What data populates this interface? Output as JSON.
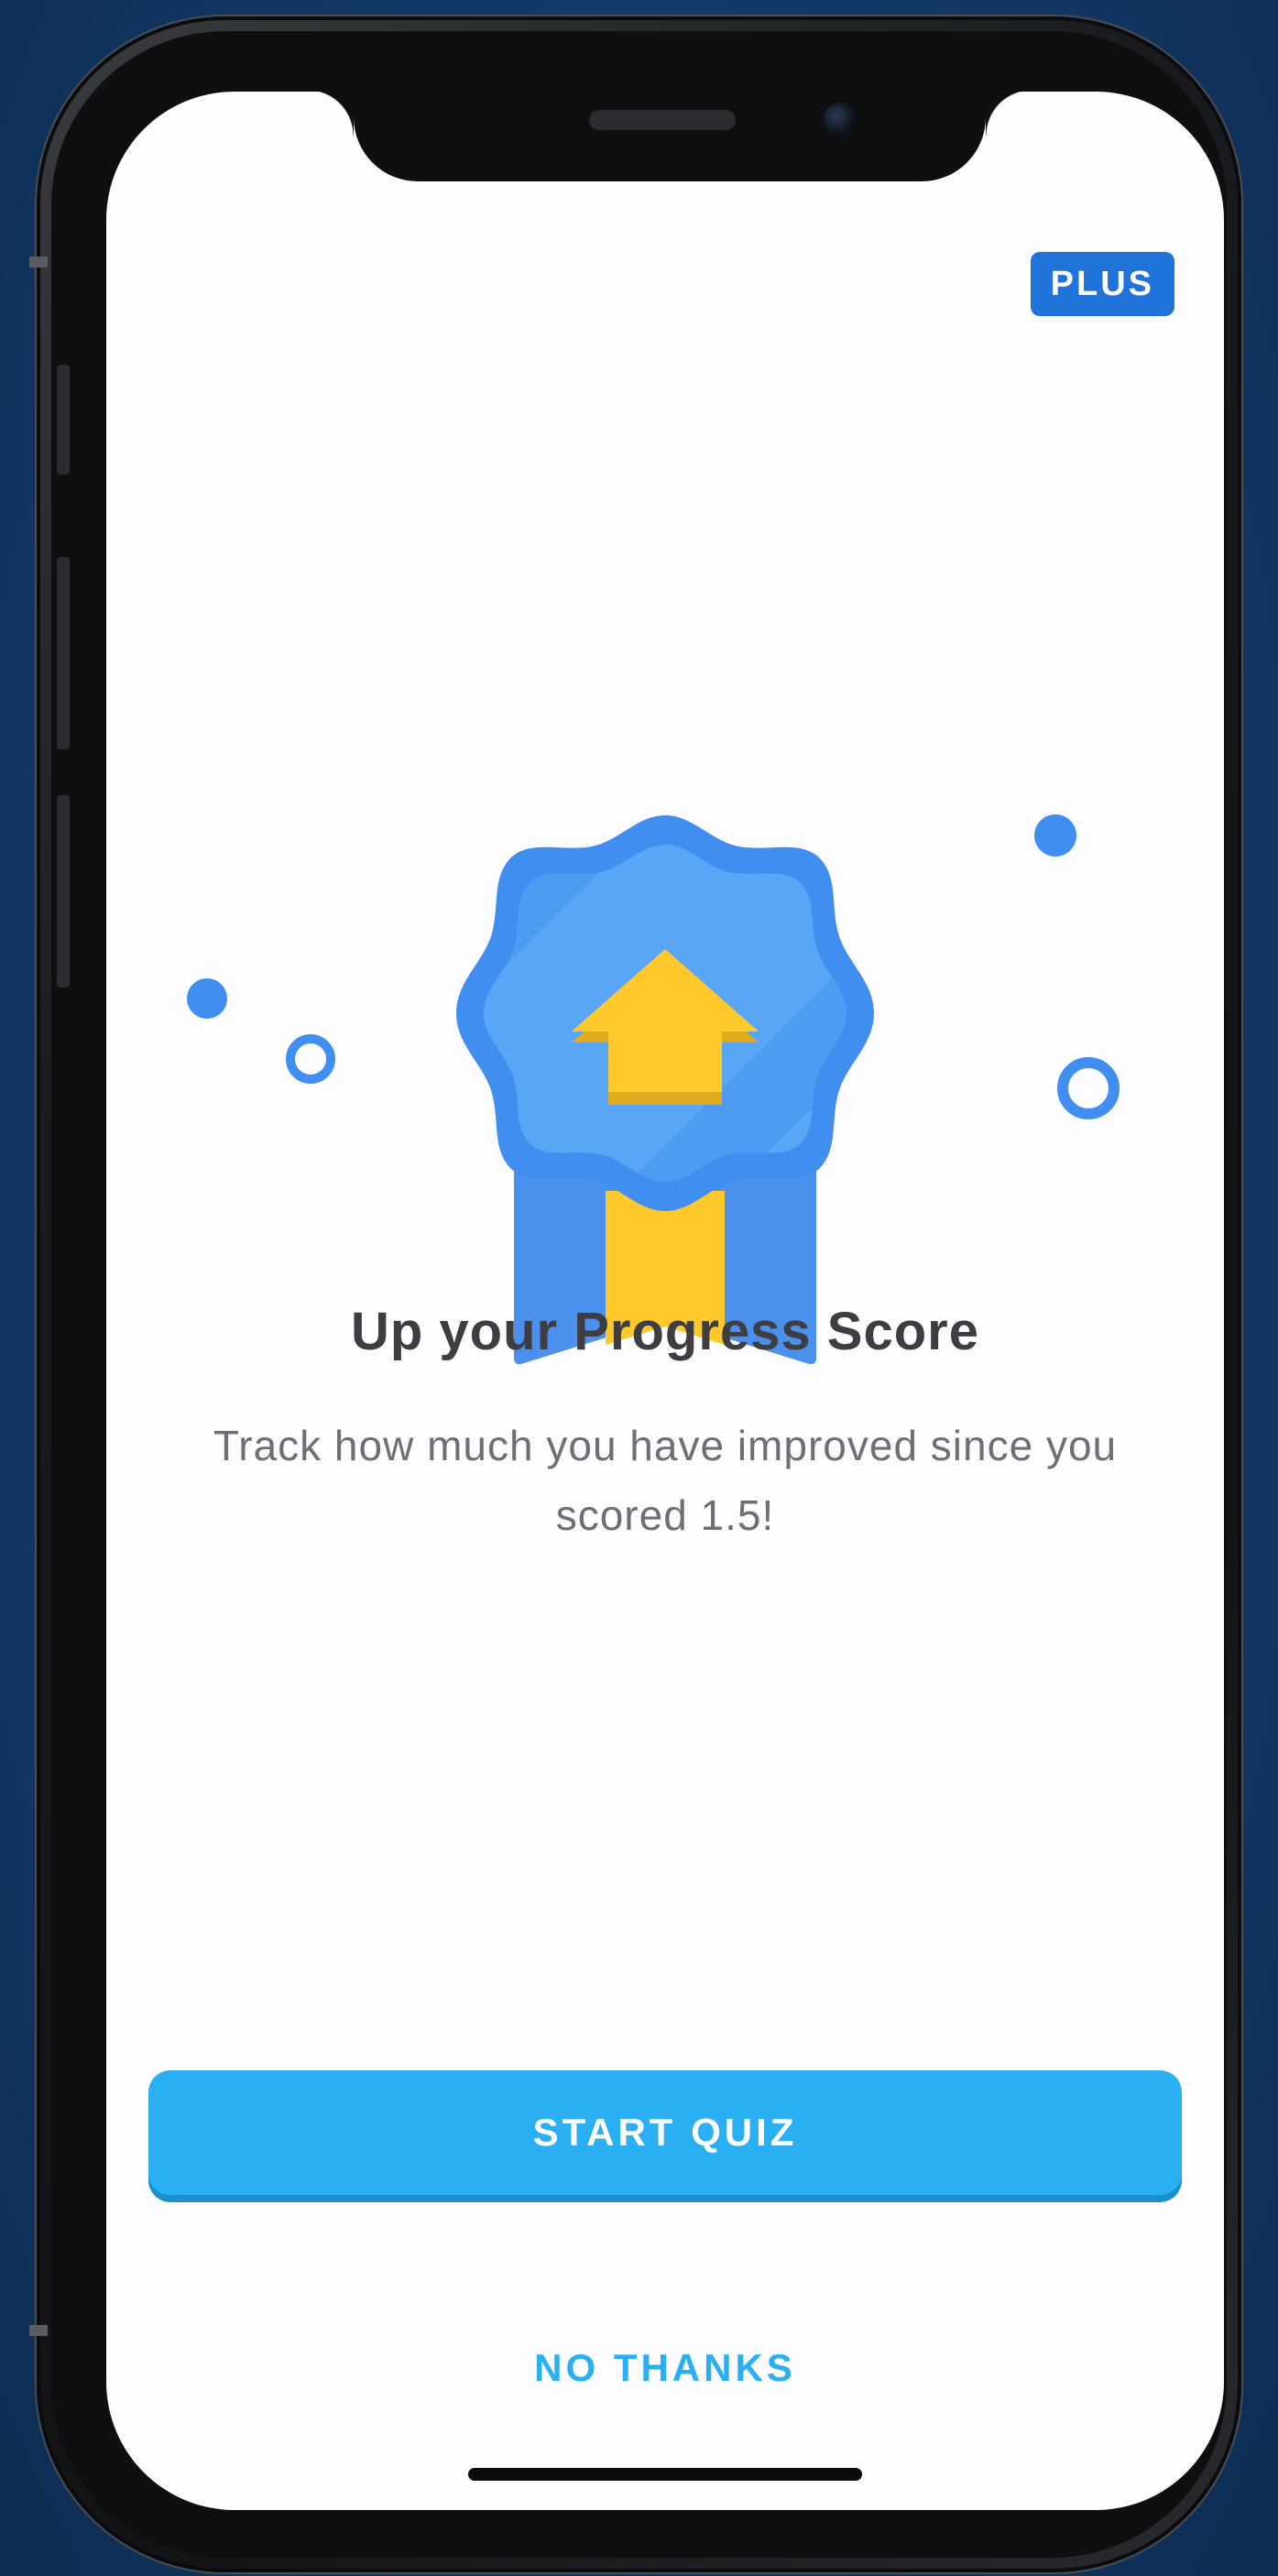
{
  "badge": {
    "label": "PLUS"
  },
  "content": {
    "title": "Up your Progress Score",
    "subtitle": "Track how much you have improved since you scored 1.5!"
  },
  "actions": {
    "start_label": "START QUIZ",
    "decline_label": "NO THANKS"
  },
  "illustration": {
    "icon": "badge-ribbon-up-arrow-icon",
    "badge_color": "#3f8ef0",
    "ribbon_color": "#4a90ec",
    "arrow_color": "#ffc92b"
  },
  "colors": {
    "primary_button": "#2ab0f2",
    "plus_badge": "#1f73d9",
    "title_text": "#3d3d42",
    "body_text": "#6e6e74",
    "background": "#fdfcfe"
  }
}
